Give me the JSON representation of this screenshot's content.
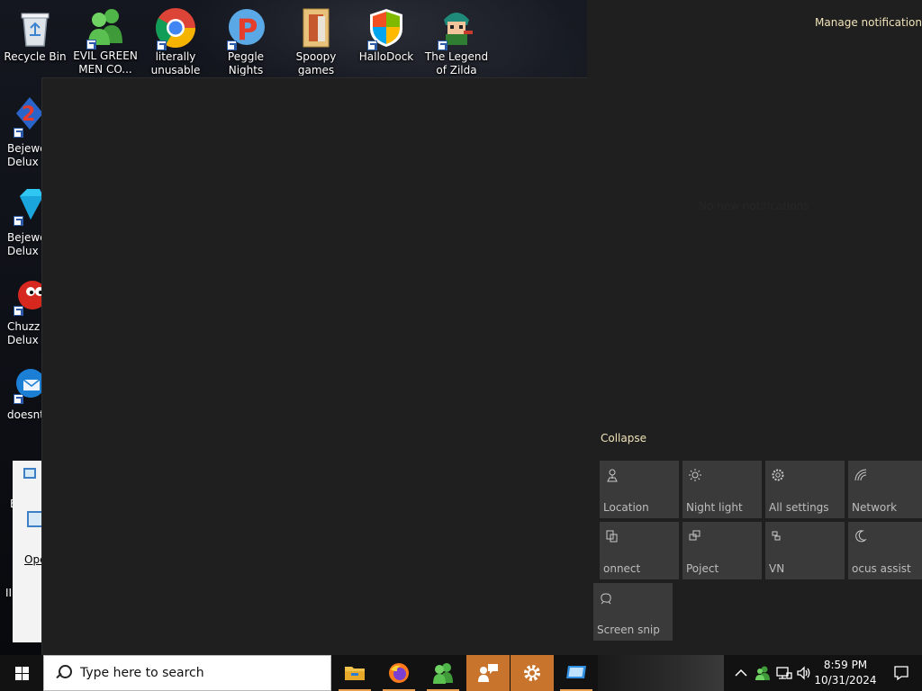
{
  "desktop": {
    "top_icons": [
      {
        "label": "Recycle Bin",
        "icon": "recycle-bin-icon",
        "shortcut": false
      },
      {
        "label": "EVIL GREEN\nMEN CO...",
        "icon": "green-men-icon",
        "shortcut": true
      },
      {
        "label": "literally\nunusable",
        "icon": "chrome-icon",
        "shortcut": true
      },
      {
        "label": "Peggle Nights\nDeluxe",
        "icon": "peggle-icon",
        "shortcut": true
      },
      {
        "label": "Spoopy\ngames",
        "icon": "folder-icon",
        "shortcut": false
      },
      {
        "label": "HalloDock",
        "icon": "shield-windows-icon",
        "shortcut": true
      },
      {
        "label": "The Legend\nof Zilda",
        "icon": "zilda-character-icon",
        "shortcut": true
      }
    ],
    "left_icons": [
      {
        "label": "Bejewel\nDelux",
        "icon": "bejeweled-2-icon"
      },
      {
        "label": "Bejewe\nDelux",
        "icon": "diamond-gem-icon"
      },
      {
        "label": "Chuzz\nDelux",
        "icon": "chuzzle-icon"
      },
      {
        "label": "doesnt",
        "icon": "thunderbird-icon"
      }
    ],
    "left_fragments": {
      "e_text": "E",
      "iin_text": "IIN"
    },
    "dialog_fragment": {
      "link_text": "Ope"
    }
  },
  "action_center": {
    "manage_notifications": "Manage notification",
    "no_notifications": "No new notifications",
    "collapse": "Collapse",
    "tiles": [
      {
        "label": "Location",
        "icon": "location-icon"
      },
      {
        "label": "Night light",
        "icon": "brightness-icon"
      },
      {
        "label": "All settings",
        "icon": "gear-icon"
      },
      {
        "label": "Network",
        "icon": "network-icon"
      },
      {
        "label": "onnect",
        "icon": "connect-icon"
      },
      {
        "label": "Poject",
        "icon": "project-icon"
      },
      {
        "label": "VN",
        "icon": "vpn-icon"
      },
      {
        "label": "ocus assist",
        "icon": "moon-icon"
      },
      {
        "label": "Screen snip",
        "icon": "snip-icon"
      }
    ]
  },
  "taskbar": {
    "search_placeholder": "Type here to search",
    "apps": [
      {
        "name": "file-explorer",
        "icon": "folder-icon"
      },
      {
        "name": "firefox",
        "icon": "firefox-icon"
      },
      {
        "name": "green-men",
        "icon": "green-men-icon"
      },
      {
        "name": "feedback",
        "icon": "feedback-hub-icon"
      },
      {
        "name": "settings",
        "icon": "gear-icon"
      },
      {
        "name": "remote-desktop",
        "icon": "remote-desktop-icon"
      }
    ],
    "time": "8:59 PM",
    "date": "10/31/2024"
  },
  "colors": {
    "accent_orange": "#c8742c",
    "link_yellow": "#f0e3b8",
    "tile_bg": "#3a3a3a",
    "panel_bg": "#1f1f1f"
  }
}
